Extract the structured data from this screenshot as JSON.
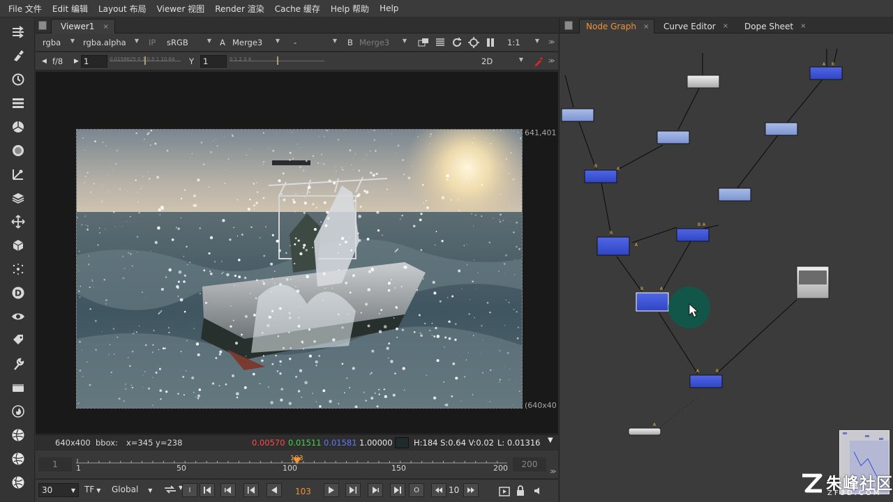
{
  "menu": [
    "File 文件",
    "Edit 编辑",
    "Layout 布局",
    "Viewer 视图",
    "Render 渲染",
    "Cache 缓存",
    "Help 帮助",
    "Help"
  ],
  "toolbar": {
    "icons": [
      "input-output-icon",
      "paint-brush-icon",
      "clock-time-icon",
      "channel-stack-icon",
      "color-wheel-icon",
      "filter-icon",
      "keyer-icon",
      "merge-layers-icon",
      "transform-move-icon",
      "3d-cube-icon",
      "particles-icon",
      "deep-icon",
      "view-eye-icon",
      "metadata-tag-icon",
      "toolsets-wrench-icon",
      "other-icon",
      "furnace-icon",
      "ocula-sphere-icon",
      "cara-sphere-icon",
      "nuke-x-icon"
    ]
  },
  "viewer": {
    "tab_label": "Viewer1",
    "tab_close": "×",
    "row1": {
      "channels": "rgba",
      "alpha": "rgba.alpha",
      "ip": "IP",
      "colorspace": "sRGB",
      "a_label": "A",
      "a_input": "Merge3",
      "op": "-",
      "b_label": "B",
      "b_input": "Merge3",
      "zoom": "1:1"
    },
    "row2": {
      "fstop_label": "f/8",
      "gain_value": "1",
      "gain_ticks": "0.0158625   0.1   0.5   1   10.64",
      "gamma_label": "Y",
      "gamma_value": "1",
      "gamma_ticks": "0       1       2       3       4",
      "view_mode": "2D"
    },
    "corner_top_right": "641,401",
    "corner_bottom_right": "(640x40",
    "info": {
      "format": "640x400",
      "bbox_label": "bbox:",
      "coords": "x=345 y=238",
      "r": "0.00570",
      "g": "0.01511",
      "b": "0.01581",
      "a": "1.00000",
      "hsv": "H:184 S:0.64 V:0.02",
      "lum": "L: 0.01316"
    },
    "timeline": {
      "in_frame": "1",
      "out_frame": "200",
      "current": "103",
      "current_value": 103,
      "range_start": 1,
      "range_end": 200,
      "labels": [
        "1",
        "50",
        "100",
        "150",
        "200"
      ]
    },
    "transport": {
      "fps": "30",
      "tf": "TF",
      "scope": "Global",
      "frame": "103",
      "increment": "10",
      "i_label": "I",
      "o_label": "O"
    }
  },
  "node_graph": {
    "tabs": [
      {
        "label": "Node Graph",
        "active": true
      },
      {
        "label": "Curve Editor",
        "active": false
      },
      {
        "label": "Dope Sheet",
        "active": false
      }
    ],
    "tab_close": "×"
  },
  "watermark": {
    "main": "朱峰社区",
    "sub": "ZF3D.COM"
  },
  "colors": {
    "accent_orange": "#f0923a",
    "node_merge": "#3c55d6",
    "node_grade": "#8fa6dd",
    "red_channel": "#ff4040",
    "green_channel": "#40e040",
    "blue_channel": "#5a78ff"
  }
}
